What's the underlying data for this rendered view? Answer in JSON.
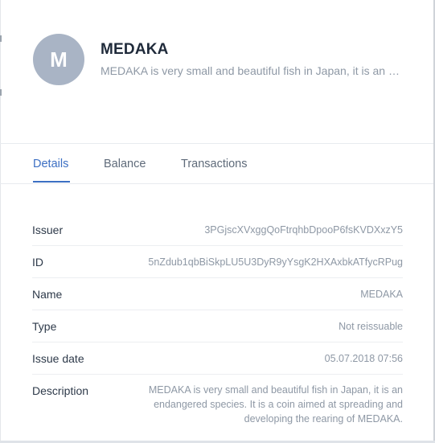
{
  "asset": {
    "avatar_letter": "M",
    "name": "MEDAKA",
    "description_preview": "MEDAKA is very small and beautiful fish in Japan, it is an endangered species. It is a coin aimed at spreading and developing the rearing of MEDAKA."
  },
  "tabs": [
    {
      "label": "Details",
      "active": true
    },
    {
      "label": "Balance",
      "active": false
    },
    {
      "label": "Transactions",
      "active": false
    }
  ],
  "details": {
    "issuer": {
      "label": "Issuer",
      "value": "3PGjscXVxggQoFtrqhbDpooP6fsKVDXxzY5"
    },
    "id": {
      "label": "ID",
      "value": "5nZdub1qbBiSkpLU5U3DyR9yYsgK2HXAxbkATfycRPug"
    },
    "name": {
      "label": "Name",
      "value": "MEDAKA"
    },
    "type": {
      "label": "Type",
      "value": "Not reissuable"
    },
    "issue_date": {
      "label": "Issue date",
      "value": "05.07.2018 07:56"
    },
    "description": {
      "label": "Description",
      "value": "MEDAKA is very small and beautiful fish in Japan, it is an endangered species. It is a coin aimed at spreading and developing the rearing of MEDAKA."
    }
  },
  "colors": {
    "accent": "#3c6fc3",
    "avatar_bg": "#a9b4c5",
    "title": "#1f2a3a",
    "muted": "#8e98a5"
  }
}
